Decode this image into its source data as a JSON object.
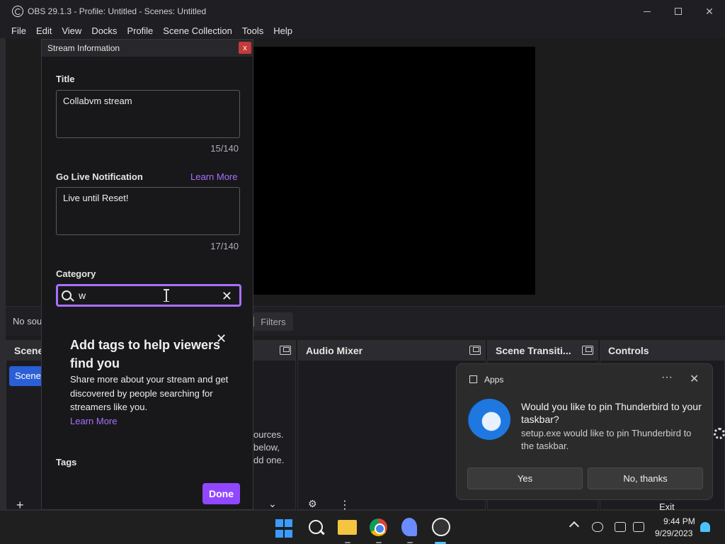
{
  "window": {
    "title": "OBS 29.1.3 - Profile: Untitled - Scenes: Untitled"
  },
  "menu": {
    "items": [
      "File",
      "Edit",
      "View",
      "Docks",
      "Profile",
      "Scene Collection",
      "Tools",
      "Help"
    ]
  },
  "source_toolbar": {
    "no_source": "No sou",
    "filters": "Filters"
  },
  "docks": {
    "scenes": {
      "title": "Scene",
      "item": "Scene"
    },
    "audio_mixer": {
      "title": "Audio Mixer"
    },
    "scene_transitions": {
      "title": "Scene Transiti..."
    },
    "controls": {
      "title": "Controls",
      "exit": "Exit"
    },
    "sources_hint": [
      "ources.",
      "below,",
      "dd one."
    ],
    "add_button": "+",
    "more_button": "⋮"
  },
  "dialog": {
    "title": "Stream Information",
    "close": "x",
    "title_label": "Title",
    "title_value": "Collabvm stream",
    "title_counter": "15/140",
    "notification_label": "Go Live Notification",
    "learn_more": "Learn More",
    "notification_value": "Live until Reset!",
    "notification_counter": "17/140",
    "category_label": "Category",
    "category_value": "w",
    "promo_title": "Add tags to help viewers find you",
    "promo_body": "Share more about your stream and get discovered by people searching for streamers like you.",
    "promo_link": "Learn More",
    "tags_label": "Tags",
    "done": "Done"
  },
  "notification": {
    "app": "Apps",
    "more": "···",
    "close": "✕",
    "title": "Would you like to pin Thunderbird to your taskbar?",
    "body": "setup.exe would like to pin Thunderbird to the taskbar.",
    "yes": "Yes",
    "no": "No, thanks"
  },
  "taskbar": {
    "time": "9:44 PM",
    "date": "9/29/2023"
  }
}
